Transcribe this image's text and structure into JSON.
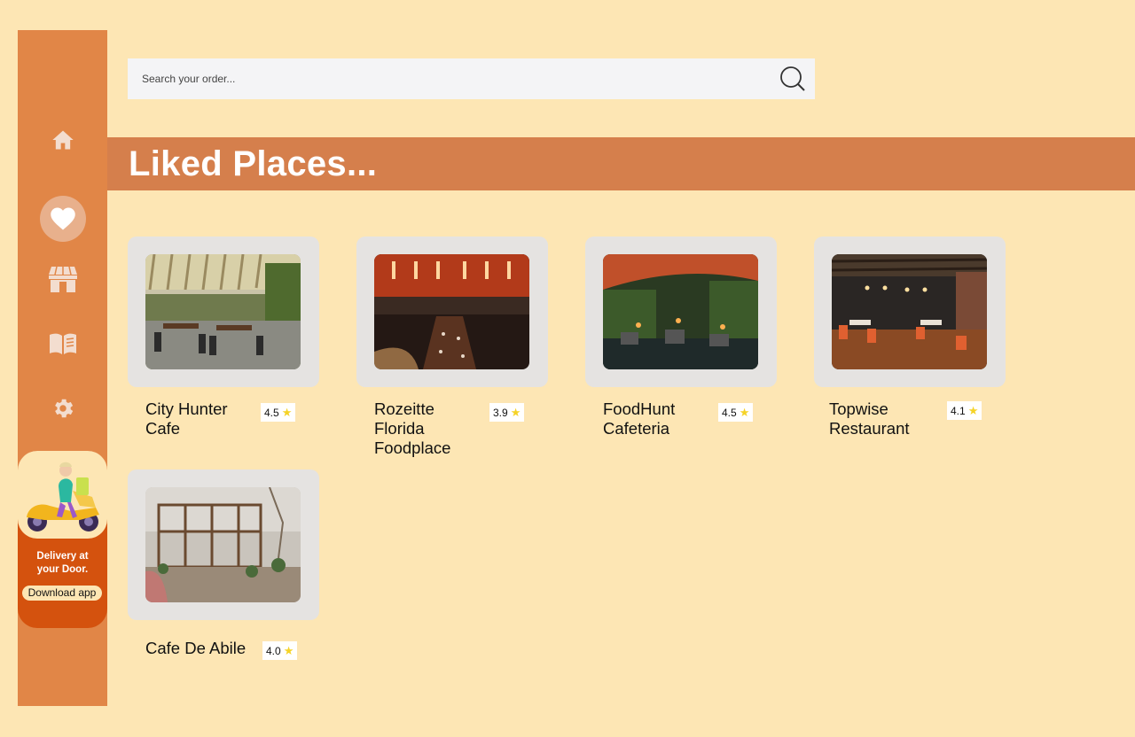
{
  "sidebar": {
    "items": [
      {
        "icon": "home-icon",
        "name": "nav-home"
      },
      {
        "icon": "heart-icon",
        "name": "nav-liked",
        "active": true
      },
      {
        "icon": "store-icon",
        "name": "nav-store"
      },
      {
        "icon": "book-icon",
        "name": "nav-menu"
      },
      {
        "icon": "gear-icon",
        "name": "nav-settings"
      }
    ],
    "promo": {
      "line1": "Delivery at",
      "line2": "your Door.",
      "button": "Download app"
    }
  },
  "search": {
    "placeholder": "Search your order...",
    "icon": "search-icon"
  },
  "banner": {
    "title": "Liked Places..."
  },
  "places": [
    {
      "name": "City Hunter Cafe",
      "rating": "4.5"
    },
    {
      "name": "Rozeitte Florida Foodplace",
      "rating": "3.9"
    },
    {
      "name": "FoodHunt Cafeteria",
      "rating": "4.5"
    },
    {
      "name": "Topwise Restaurant",
      "rating": "4.1"
    },
    {
      "name": "Cafe De Abile",
      "rating": "4.0"
    }
  ],
  "colors": {
    "background": "#fde6b4",
    "sidebar": "#e18647",
    "banner": "#d57f4c",
    "promo": "#d4520e",
    "star": "#f5d327"
  }
}
